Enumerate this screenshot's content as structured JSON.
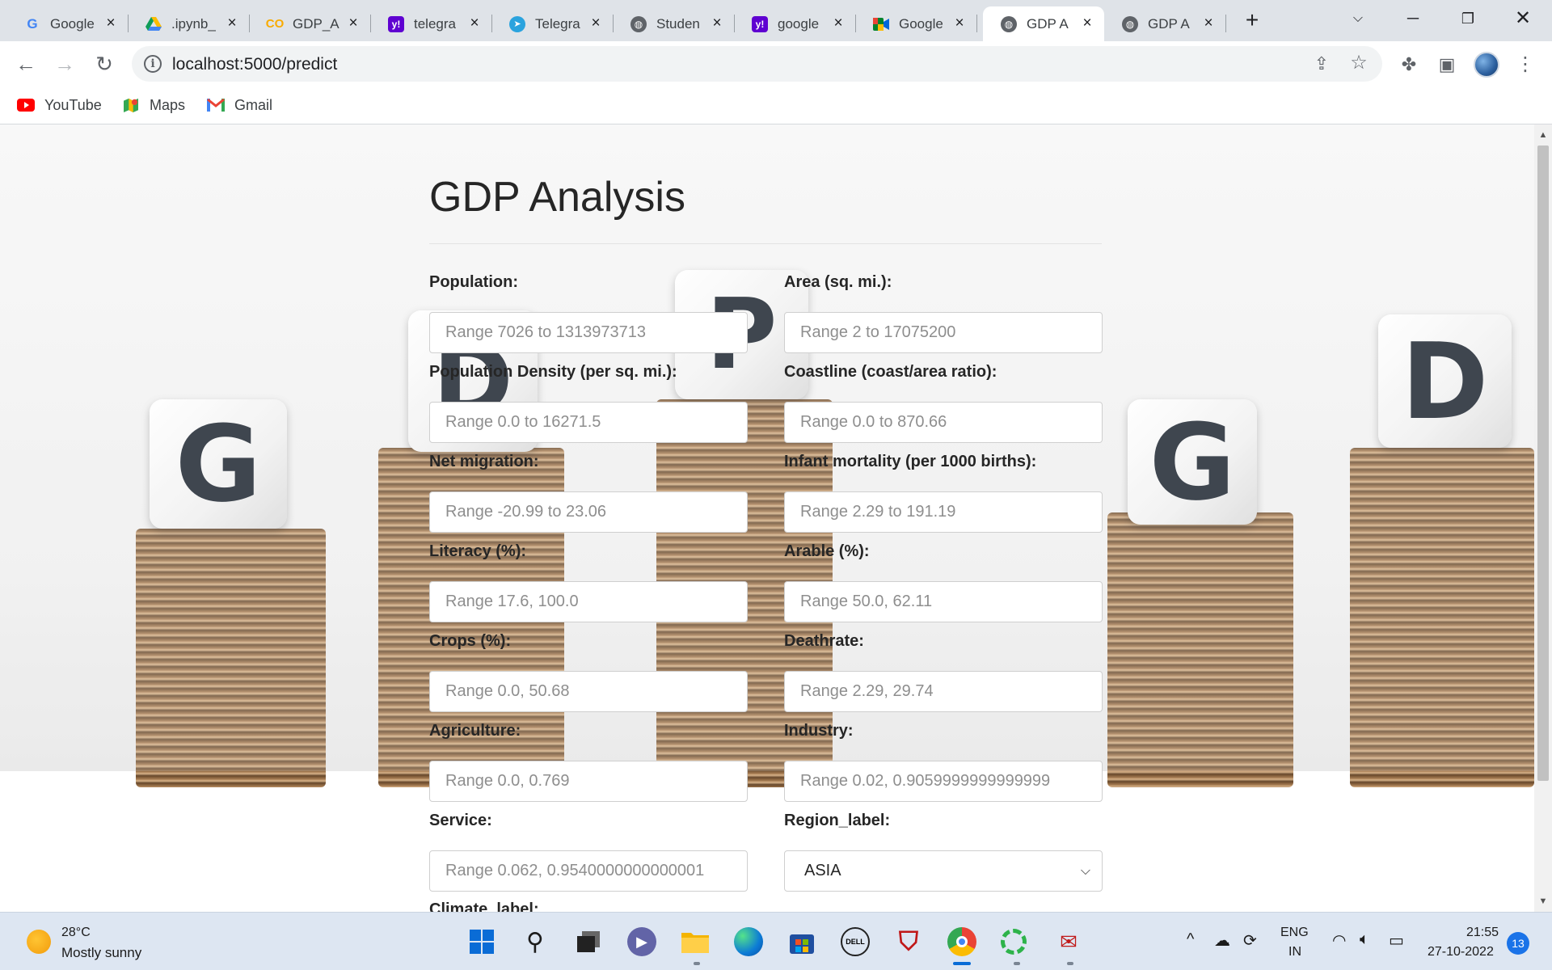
{
  "browser": {
    "tabs": [
      {
        "title": "Google",
        "icon": "google-icon"
      },
      {
        "title": ".ipynb_",
        "icon": "google-drive-icon"
      },
      {
        "title": "GDP_A",
        "icon": "colab-icon"
      },
      {
        "title": "telegra",
        "icon": "yahoo-icon"
      },
      {
        "title": "Telegra",
        "icon": "telegram-icon"
      },
      {
        "title": "Studen",
        "icon": "globe-icon"
      },
      {
        "title": "google",
        "icon": "yahoo-icon"
      },
      {
        "title": "Google",
        "icon": "google-meet-icon"
      },
      {
        "title": "GDP A",
        "icon": "globe-icon"
      },
      {
        "title": "GDP A",
        "icon": "globe-icon"
      }
    ],
    "url": "localhost:5000/predict",
    "bookmarks": [
      {
        "label": "YouTube",
        "icon": "youtube-icon"
      },
      {
        "label": "Maps",
        "icon": "google-maps-icon"
      },
      {
        "label": "Gmail",
        "icon": "gmail-icon"
      }
    ]
  },
  "page": {
    "title": "GDP Analysis",
    "fields": [
      {
        "label": "Population:",
        "placeholder": "Range 7026 to 1313973713"
      },
      {
        "label": "Area (sq. mi.):",
        "placeholder": "Range 2 to 17075200"
      },
      {
        "label": "Population Density (per sq. mi.):",
        "placeholder": "Range 0.0 to 16271.5"
      },
      {
        "label": "Coastline (coast/area ratio):",
        "placeholder": "Range 0.0 to 870.66"
      },
      {
        "label": "Net migration:",
        "placeholder": "Range -20.99 to 23.06"
      },
      {
        "label": "Infant mortality (per 1000 births):",
        "placeholder": "Range 2.29 to 191.19"
      },
      {
        "label": "Literacy (%):",
        "placeholder": "Range 17.6, 100.0"
      },
      {
        "label": "Arable (%):",
        "placeholder": "Range 50.0, 62.11"
      },
      {
        "label": "Crops (%):",
        "placeholder": "Range 0.0, 50.68"
      },
      {
        "label": "Deathrate:",
        "placeholder": "Range 2.29, 29.74"
      },
      {
        "label": "Agriculture:",
        "placeholder": "Range 0.0, 0.769"
      },
      {
        "label": "Industry:",
        "placeholder": "Range 0.02, 0.9059999999999999"
      },
      {
        "label": "Service:",
        "placeholder": "Range 0.062, 0.9540000000000001"
      }
    ],
    "region": {
      "label": "Region_label:",
      "selected": "ASIA"
    },
    "climate": {
      "label": "Climate_label:"
    },
    "background_letters": [
      "G",
      "D",
      "P",
      "G",
      "D"
    ]
  },
  "taskbar": {
    "weather": {
      "temp": "28°C",
      "desc": "Mostly sunny"
    },
    "apps": [
      "windows-start-icon",
      "search-icon",
      "task-view-icon",
      "teams-chat-icon",
      "file-explorer-icon",
      "edge-icon",
      "microsoft-store-icon",
      "dell-icon",
      "mcafee-icon",
      "chrome-icon",
      "spinner-app-icon",
      "mail-app-icon"
    ],
    "lang": {
      "line1": "ENG",
      "line2": "IN"
    },
    "time": "21:55",
    "date": "27-10-2022",
    "notifications": "13"
  }
}
